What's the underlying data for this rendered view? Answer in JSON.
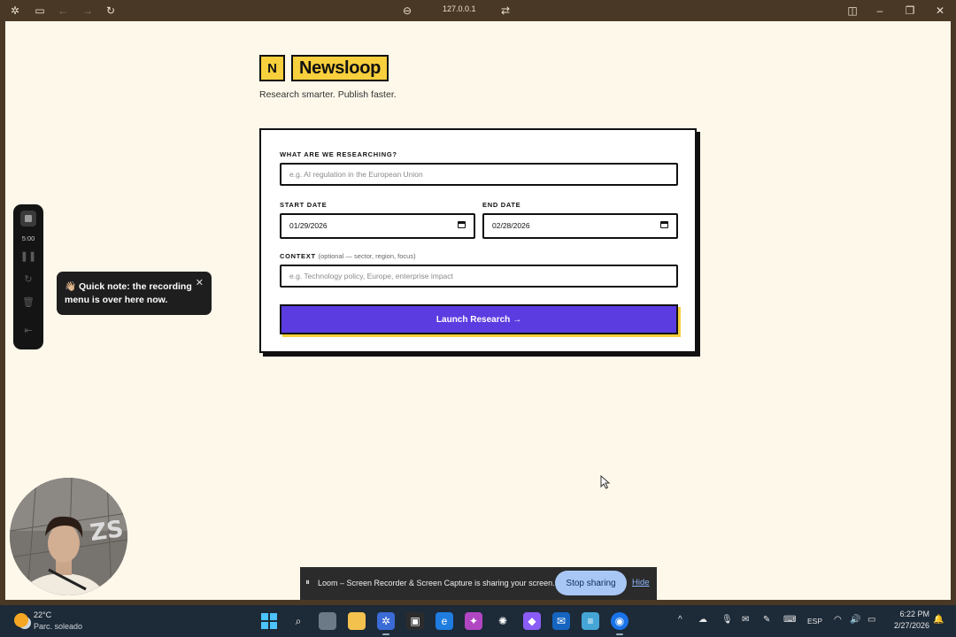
{
  "browser": {
    "url": "127.0.0.1",
    "icons": [
      "app-menu-icon",
      "sidebar-icon",
      "back-icon",
      "forward-icon",
      "reload-icon",
      "link-icon",
      "site-settings-icon",
      "split-view-icon",
      "minimize-icon",
      "maximize-icon",
      "close-icon"
    ]
  },
  "app": {
    "logo_letter": "N",
    "logo_word": "Newsloop",
    "tagline": "Research smarter. Publish faster."
  },
  "form": {
    "topic_label": "WHAT ARE WE RESEARCHING?",
    "topic_placeholder": "e.g. AI regulation in the European Union",
    "start_label": "START DATE",
    "start_value": "01/29/2026",
    "end_label": "END DATE",
    "end_value": "02/28/2026",
    "context_label": "CONTEXT",
    "context_hint": "(optional — sector, region, focus)",
    "context_placeholder": "e.g. Technology policy, Europe, enterprise impact",
    "launch_label": "Launch Research →"
  },
  "colors": {
    "accent": "#5b3ce0",
    "brand_yellow": "#f8cf3c",
    "page_bg": "#fdf8ea"
  },
  "loom": {
    "timer": "5:00",
    "tooltip": "👋🏼 Quick note: the recording menu is over here now.",
    "share_message": "Loom – Screen Recorder & Screen Capture is sharing your screen.",
    "stop_label": "Stop sharing",
    "hide_label": "Hide"
  },
  "taskbar": {
    "temp": "22°C",
    "condition": "Parc. soleado",
    "lang": "ESP",
    "time": "6:22 PM",
    "date": "2/27/2026"
  }
}
